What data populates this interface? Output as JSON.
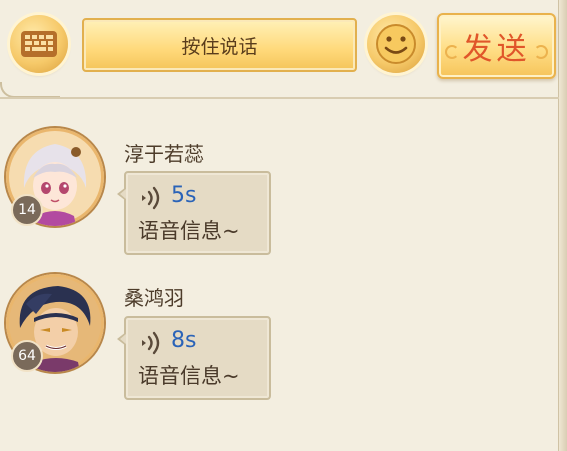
{
  "toolbar": {
    "keyboard_icon": "keyboard-icon",
    "talk_label": "按住说话",
    "emoji_icon": "smiley-icon",
    "send_label": "发送"
  },
  "messages": [
    {
      "name": "淳于若蕊",
      "level": "14",
      "duration": "5s",
      "text": "语音信息~",
      "icon": "voice-wave-icon"
    },
    {
      "name": "桑鸿羽",
      "level": "64",
      "duration": "8s",
      "text": "语音信息~",
      "icon": "voice-wave-icon"
    }
  ],
  "colors": {
    "background": "#f3eee0",
    "accent": "#ffd97a",
    "send_text": "#e0562a",
    "duration_text": "#2a63b8"
  }
}
